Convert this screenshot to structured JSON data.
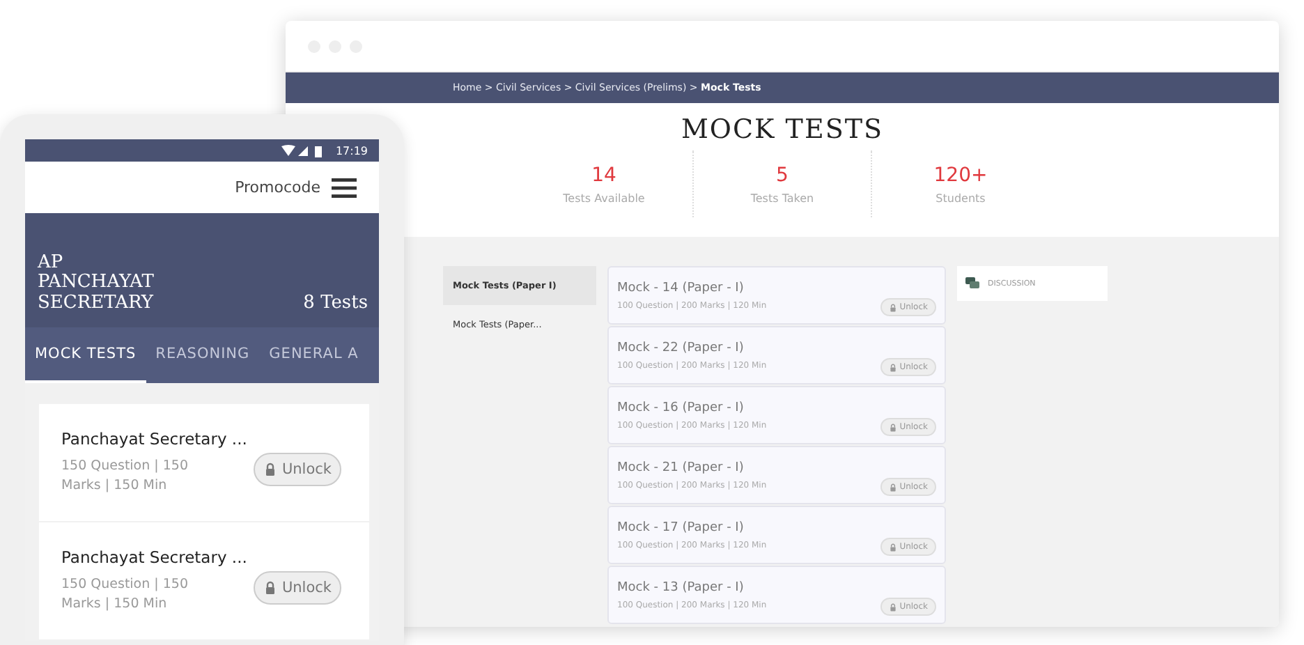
{
  "browser": {
    "breadcrumb": "Home > Civil Services > Civil Services (Prelims) > **Mock Tests**",
    "title": "MOCK TESTS",
    "stats": [
      {
        "value": "14",
        "label": "Tests Available"
      },
      {
        "value": "5",
        "label": "Tests Taken"
      },
      {
        "value": "120+",
        "label": "Students"
      }
    ],
    "sidebar": [
      {
        "label": "Mock Tests (Paper I)",
        "selected": true
      },
      {
        "label": "Mock Tests (Paper...",
        "selected": false
      }
    ],
    "tests": [
      {
        "title": "Mock - 14 (Paper - I)",
        "meta": "100 Question |  200 Marks | 120 Min",
        "button": "Unlock"
      },
      {
        "title": "Mock - 22 (Paper - I)",
        "meta": "100 Question |  200 Marks | 120 Min",
        "button": "Unlock"
      },
      {
        "title": "Mock - 16 (Paper - I)",
        "meta": "100 Question |  200 Marks | 120 Min",
        "button": "Unlock"
      },
      {
        "title": "Mock - 21 (Paper - I)",
        "meta": "100 Question |  200 Marks | 120 Min",
        "button": "Unlock"
      },
      {
        "title": "Mock - 17 (Paper - I)",
        "meta": "100 Question |  200 Marks | 120 Min",
        "button": "Unlock"
      },
      {
        "title": "Mock - 13 (Paper - I)",
        "meta": "100 Question |  200 Marks | 120 Min",
        "button": "Unlock"
      }
    ],
    "discussion": "DISCUSSION"
  },
  "phone": {
    "time": "17:19",
    "promocode": "Promocode",
    "header_title": "AP PANCHAYAT SECRETARY",
    "test_count": "8 Tests",
    "tabs": [
      {
        "label": "MOCK TESTS",
        "selected": true
      },
      {
        "label": "REASONING",
        "selected": false
      },
      {
        "label": "GENERAL A",
        "selected": false
      }
    ],
    "cards": [
      {
        "title": "Panchayat Secretary ...",
        "meta": "150 Question |  150 Marks | 150 Min",
        "button": "Unlock"
      },
      {
        "title": "Panchayat Secretary ...",
        "meta": "150 Question |  150 Marks | 150 Min",
        "button": "Unlock"
      }
    ]
  }
}
